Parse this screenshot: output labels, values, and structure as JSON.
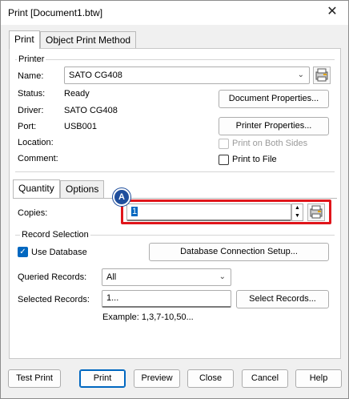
{
  "window": {
    "title": "Print [Document1.btw]"
  },
  "tabs": [
    {
      "label": "Print"
    },
    {
      "label": "Object Print Method"
    }
  ],
  "printer": {
    "group_label": "Printer",
    "name_label": "Name:",
    "name_value": "SATO CG408",
    "status_label": "Status:",
    "status_value": "Ready",
    "driver_label": "Driver:",
    "driver_value": "SATO CG408",
    "port_label": "Port:",
    "port_value": "USB001",
    "location_label": "Location:",
    "comment_label": "Comment:",
    "document_properties": "Document Properties...",
    "printer_properties": "Printer Properties...",
    "print_both_sides": "Print on Both Sides",
    "print_to_file": "Print to File"
  },
  "subtabs": [
    {
      "label": "Quantity"
    },
    {
      "label": "Options"
    }
  ],
  "quantity": {
    "copies_label": "Copies:",
    "copies_value": "1",
    "badge": "A"
  },
  "records": {
    "group_label": "Record Selection",
    "use_database_label": "Use Database",
    "use_database_checked": true,
    "db_setup_button": "Database Connection Setup...",
    "queried_label": "Queried Records:",
    "queried_value": "All",
    "selected_label": "Selected Records:",
    "selected_value": "1...",
    "select_records_button": "Select Records...",
    "example": "Example: 1,3,7-10,50..."
  },
  "footer": {
    "test_print": "Test Print",
    "print": "Print",
    "preview": "Preview",
    "close": "Close",
    "cancel": "Cancel",
    "help": "Help"
  },
  "colors": {
    "highlight": "#e0151b",
    "badge": "#1f4e9c",
    "accent": "#0067c0"
  }
}
